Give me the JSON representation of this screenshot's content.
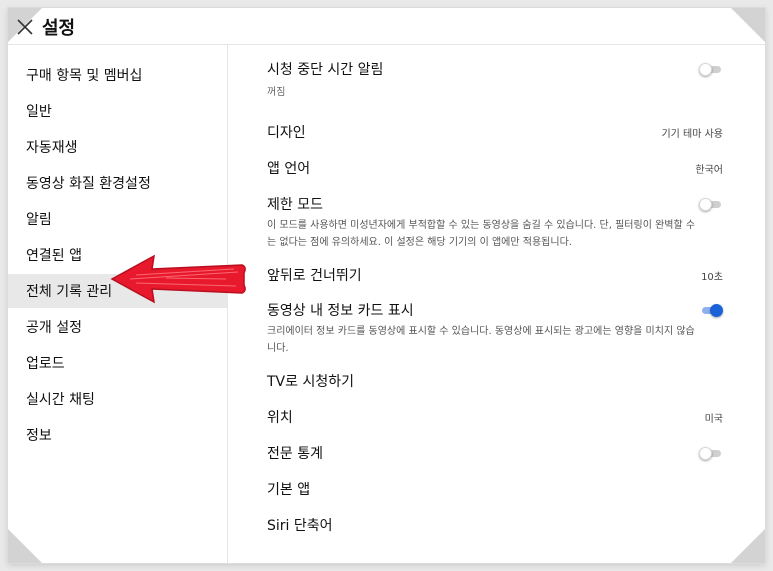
{
  "header": {
    "title": "설정",
    "close_icon": "close-icon"
  },
  "sidebar": {
    "items": [
      {
        "label": "구매 항목 및 멤버십"
      },
      {
        "label": "일반"
      },
      {
        "label": "자동재생"
      },
      {
        "label": "동영상 화질 환경설정"
      },
      {
        "label": "알림"
      },
      {
        "label": "연결된 앱"
      },
      {
        "label": "전체 기록 관리",
        "active": true
      },
      {
        "label": "공개 설정"
      },
      {
        "label": "업로드"
      },
      {
        "label": "실시간 채팅"
      },
      {
        "label": "정보"
      }
    ],
    "annotation_arrow_color": "#e8192c"
  },
  "settings": {
    "break_reminder": {
      "label": "시청 중단 시간 알림",
      "sub": "꺼짐",
      "on": false
    },
    "design": {
      "label": "디자인",
      "value": "기기 테마 사용"
    },
    "app_language": {
      "label": "앱 언어",
      "value": "한국어"
    },
    "restricted_mode": {
      "label": "제한 모드",
      "desc": "이 모드를 사용하면 미성년자에게 부적합할 수 있는 동영상을 숨길 수 있습니다. 단, 필터링이 완벽할 수는 없다는 점에 유의하세요. 이 설정은 해당 기기의 이 앱에만 적용됩니다.",
      "on": false
    },
    "seek": {
      "label": "앞뒤로 건너뛰기",
      "value": "10초"
    },
    "info_cards": {
      "label": "동영상 내 정보 카드 표시",
      "desc": "크리에이터 정보 카드를 동영상에 표시할 수 있습니다. 동영상에 표시되는 광고에는 영향을 미치지 않습니다.",
      "on": true
    },
    "watch_on_tv": {
      "label": "TV로 시청하기"
    },
    "location": {
      "label": "위치",
      "value": "미국"
    },
    "stats_for_nerds": {
      "label": "전문 통계",
      "on": false
    },
    "default_apps": {
      "label": "기본 앱"
    },
    "siri_shortcuts": {
      "label": "Siri 단축어"
    }
  },
  "colors": {
    "toggle_on": "#1a62d8",
    "toggle_off": "#cfcfcf",
    "active_sidebar_bg": "#e8e8e8"
  }
}
